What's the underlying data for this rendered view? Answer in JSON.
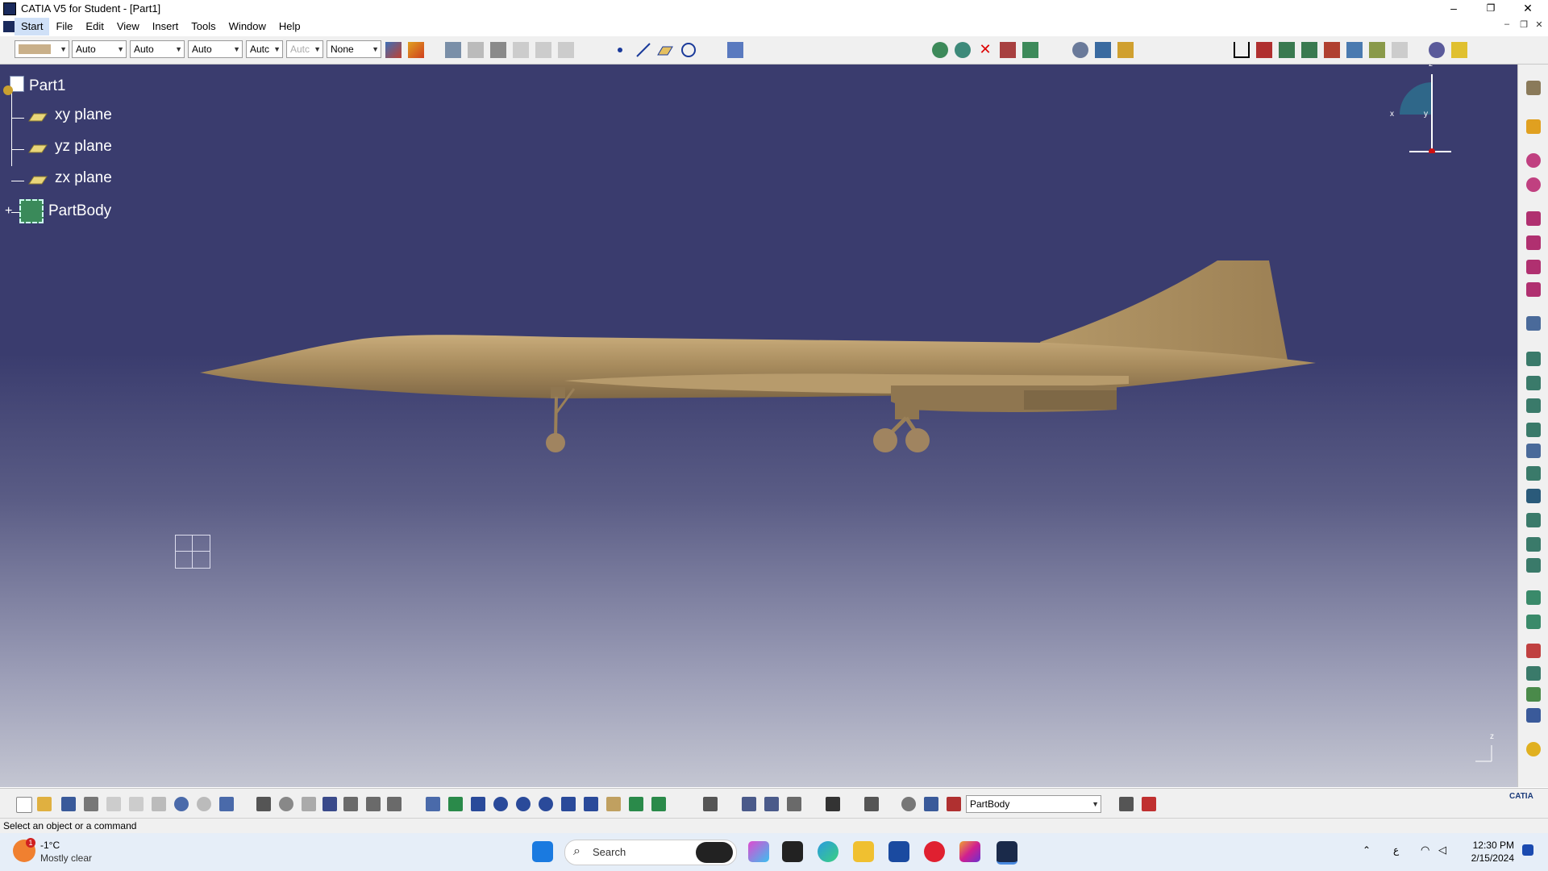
{
  "window": {
    "title": "CATIA V5 for Student - [Part1]",
    "controls": {
      "minimize": "–",
      "restore": "❐",
      "close": "✕"
    },
    "mdi_controls": {
      "minimize": "–",
      "restore": "❐",
      "close": "✕"
    }
  },
  "menu": [
    "Start",
    "File",
    "Edit",
    "View",
    "Insert",
    "Tools",
    "Window",
    "Help"
  ],
  "toolbar": {
    "color_combo": "",
    "combos": [
      "Auto",
      "Auto",
      "Auto",
      "Autc",
      "Autc"
    ],
    "layer_combo": "None"
  },
  "tree": {
    "root": "Part1",
    "children": [
      "xy plane",
      "yz plane",
      "zx plane",
      "PartBody"
    ]
  },
  "compass": {
    "x_label": "x",
    "y_label": "y",
    "z_label": "z"
  },
  "axis_label": "z",
  "bottom_toolbar": {
    "current_body": "PartBody"
  },
  "status": {
    "message": "Select an object or a command"
  },
  "taskbar": {
    "weather_temp": "-1°C",
    "weather_desc": "Mostly clear",
    "weather_badge": "1",
    "search_placeholder": "Search",
    "time": "12:30 PM",
    "date": "2/15/2024",
    "lang": "ع"
  },
  "colors": {
    "viewport_top": "#3a3c6e",
    "viewport_bottom": "#c4c6d2",
    "model": "#a58a5c",
    "model_light": "#c2a574",
    "model_dark": "#7e6642"
  },
  "catia_logo": "CATIA"
}
